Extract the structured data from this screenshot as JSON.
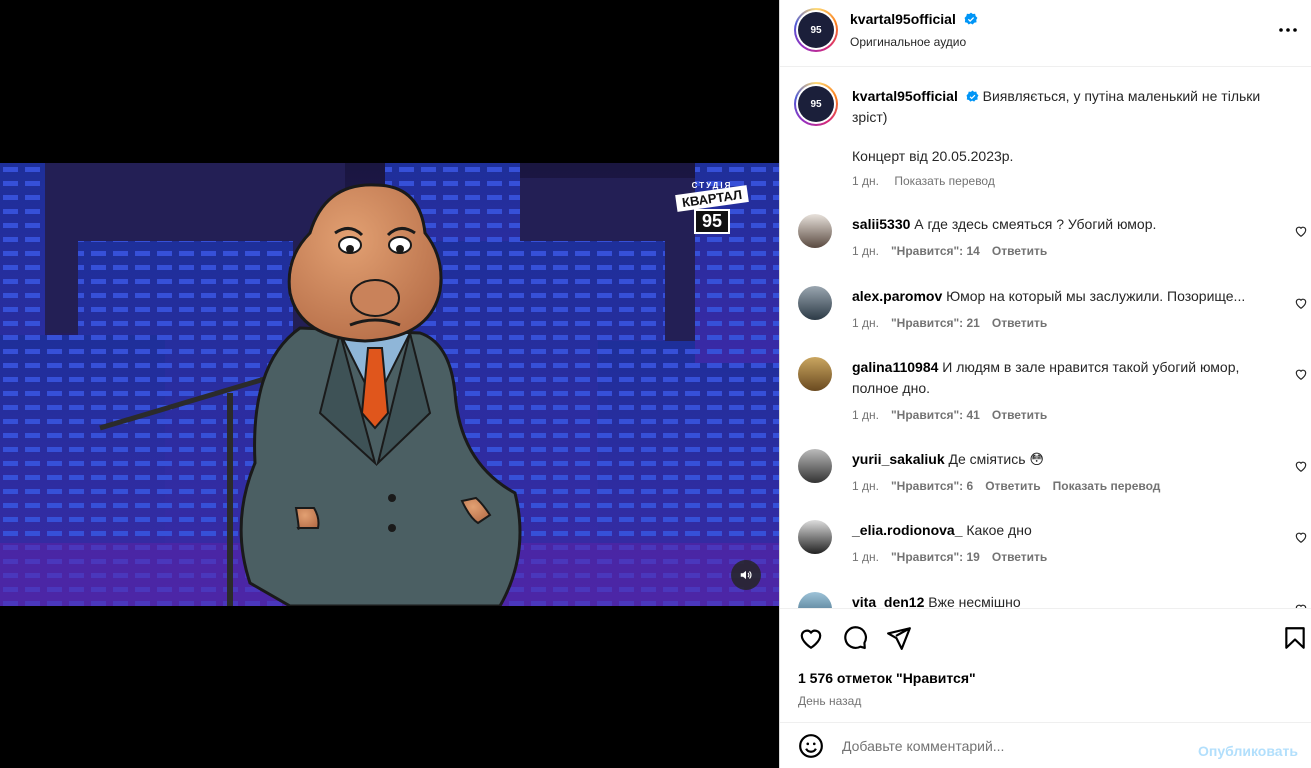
{
  "media": {
    "watermark_small": "СТУДІЯ",
    "watermark_big": "КВАРТАЛ",
    "watermark_num": "95",
    "volume_icon": "speaker-icon"
  },
  "header": {
    "username": "kvartal95official",
    "subtitle": "Оригинальное аудио",
    "more_icon": "more-horizontal-icon"
  },
  "caption": {
    "username": "kvartal95official",
    "text": "Виявляється, у путіна маленький не тільки зріст)",
    "text2": "Концерт від 20.05.2023р.",
    "time": "1 дн.",
    "translate": "Показать перевод"
  },
  "comments": [
    {
      "user": "salii5330",
      "text": "А где здесь смеяться ? Убогий юмор.",
      "time": "1 дн.",
      "likes": "\"Нравится\": 14",
      "reply": "Ответить",
      "translate": ""
    },
    {
      "user": "alex.paromov",
      "text": "Юмор на который мы заслужили. Позорище...",
      "time": "1 дн.",
      "likes": "\"Нравится\": 21",
      "reply": "Ответить",
      "translate": ""
    },
    {
      "user": "galina110984",
      "text": "И людям в зале нравится такой убогий юмор, полное дно.",
      "time": "1 дн.",
      "likes": "\"Нравится\": 41",
      "reply": "Ответить",
      "translate": ""
    },
    {
      "user": "yurii_sakaliuk",
      "text": "Де сміятись 😳",
      "time": "1 дн.",
      "likes": "\"Нравится\": 6",
      "reply": "Ответить",
      "translate": "Показать перевод"
    },
    {
      "user": "_elia.rodionova_",
      "text": "Какое дно",
      "time": "1 дн.",
      "likes": "\"Нравится\": 19",
      "reply": "Ответить",
      "translate": ""
    },
    {
      "user": "vita_den12",
      "text": "Вже несмішно",
      "time": "",
      "likes": "",
      "reply": "",
      "translate": ""
    }
  ],
  "footer": {
    "likes": "1 576 отметок \"Нравится\"",
    "ago": "День назад",
    "comment_placeholder": "Добавьте комментарий...",
    "publish": "Опубликовать"
  },
  "colors": {
    "link_blue": "#0095f6",
    "publish_disabled": "#b2dffc",
    "meta_gray": "#737373",
    "verified": "#0095f6"
  }
}
